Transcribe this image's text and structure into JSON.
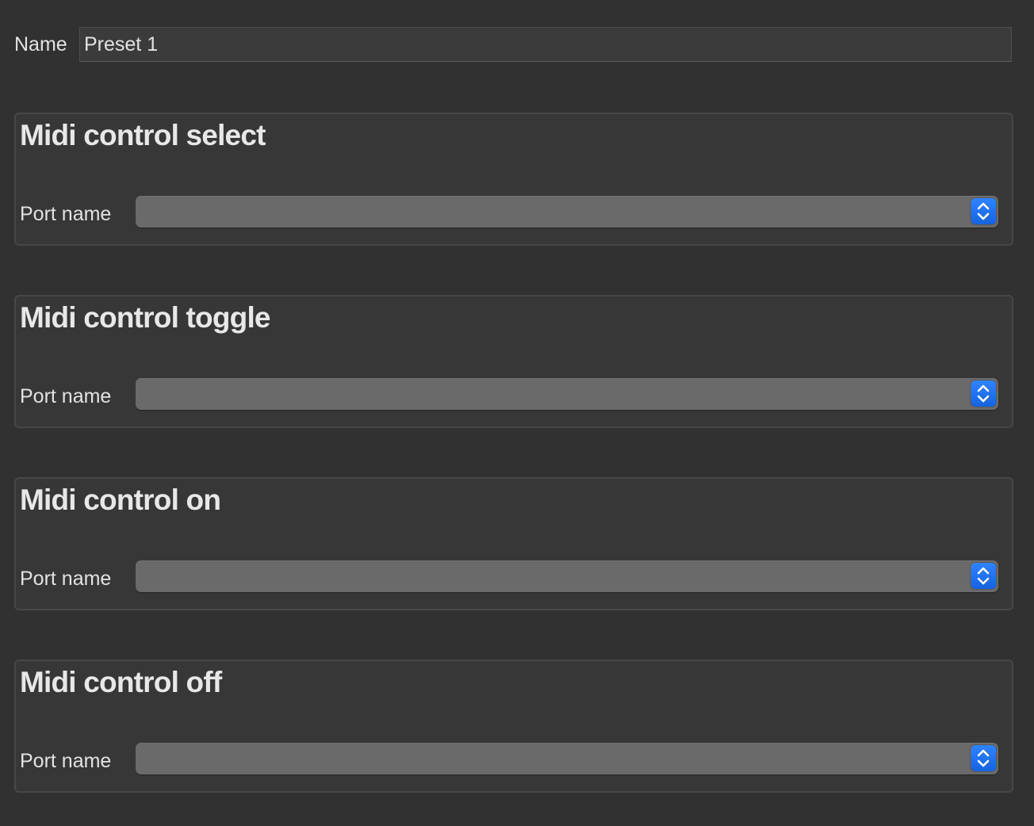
{
  "name_field": {
    "label": "Name",
    "value": "Preset 1"
  },
  "groups": [
    {
      "title": "Midi control select",
      "port_label": "Port name",
      "port_value": "",
      "icon": "chevron-up-down-icon"
    },
    {
      "title": "Midi control toggle",
      "port_label": "Port name",
      "port_value": "",
      "icon": "chevron-up-down-icon"
    },
    {
      "title": "Midi control on",
      "port_label": "Port name",
      "port_value": "",
      "icon": "chevron-up-down-icon"
    },
    {
      "title": "Midi control off",
      "port_label": "Port name",
      "port_value": "",
      "icon": "chevron-up-down-icon"
    }
  ],
  "colors": {
    "background": "#313131",
    "group_background": "#373737",
    "popup_background": "#6a6a6a",
    "accent": "#1f75f2",
    "text": "#e3e3e3"
  }
}
